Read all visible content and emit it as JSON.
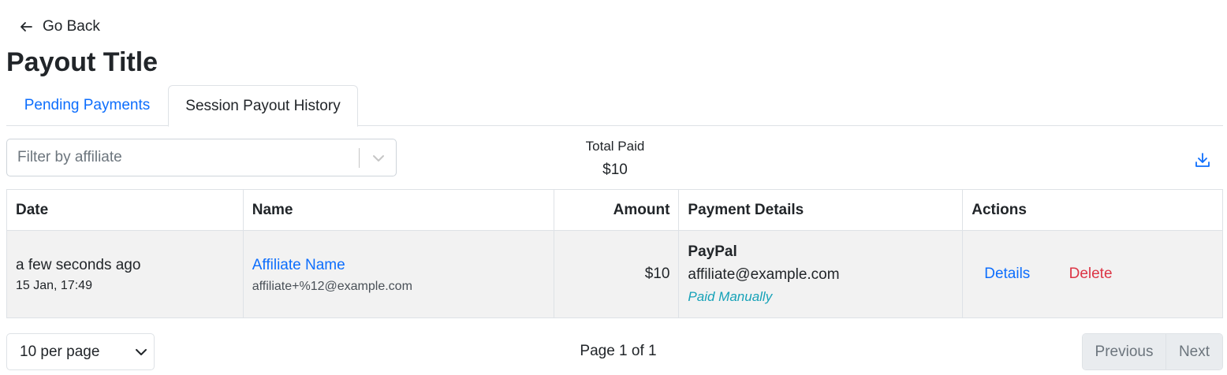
{
  "nav": {
    "go_back_label": "Go Back"
  },
  "page": {
    "title": "Payout Title"
  },
  "tabs": [
    {
      "label": "Pending Payments",
      "active": false
    },
    {
      "label": "Session Payout History",
      "active": true
    }
  ],
  "filter": {
    "placeholder": "Filter by affiliate"
  },
  "summary": {
    "total_label": "Total Paid",
    "total_value": "$10"
  },
  "table": {
    "columns": [
      "Date",
      "Name",
      "Amount",
      "Payment Details",
      "Actions"
    ],
    "rows": [
      {
        "relative_time": "a few seconds ago",
        "datetime": "15 Jan, 17:49",
        "affiliate_name": "Affiliate Name",
        "affiliate_email": "affiliate+%12@example.com",
        "amount": "$10",
        "payment_method": "PayPal",
        "payment_email": "affiliate@example.com",
        "payment_status": "Paid Manually",
        "actions": {
          "details": "Details",
          "delete": "Delete"
        }
      }
    ]
  },
  "pagination": {
    "per_page_label": "10 per page",
    "page_info": "Page 1 of 1",
    "previous_label": "Previous",
    "next_label": "Next"
  },
  "colors": {
    "link": "#0d6efd",
    "danger": "#dc3545",
    "info": "#17a2b8",
    "row_bg": "#f2f2f2",
    "border": "#dee2e6"
  },
  "icons": {
    "back": "arrow-left-icon",
    "dropdown": "chevron-down-icon",
    "download": "download-icon"
  }
}
